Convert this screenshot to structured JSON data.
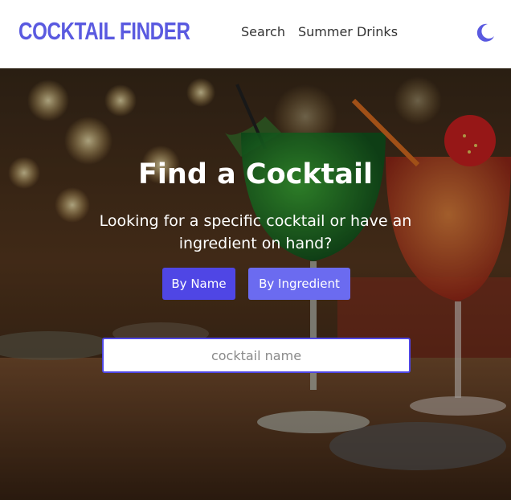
{
  "header": {
    "brand": "COCKTAIL FINDER",
    "nav": [
      {
        "label": "Search"
      },
      {
        "label": "Summer Drinks"
      }
    ],
    "theme_icon": "moon-icon"
  },
  "hero": {
    "title": "Find a Cocktail",
    "subtitle": "Looking for a specific cocktail or have an ingredient on hand?",
    "buttons": [
      {
        "label": "By Name",
        "active": true
      },
      {
        "label": "By Ingredient",
        "active": false
      }
    ],
    "search": {
      "value": "",
      "placeholder": "cocktail name"
    },
    "background_image": "cocktail-bar-photo"
  },
  "colors": {
    "brand": "#5a5ae0",
    "primary": "#4f46e5",
    "secondary": "#6b6bf0"
  }
}
